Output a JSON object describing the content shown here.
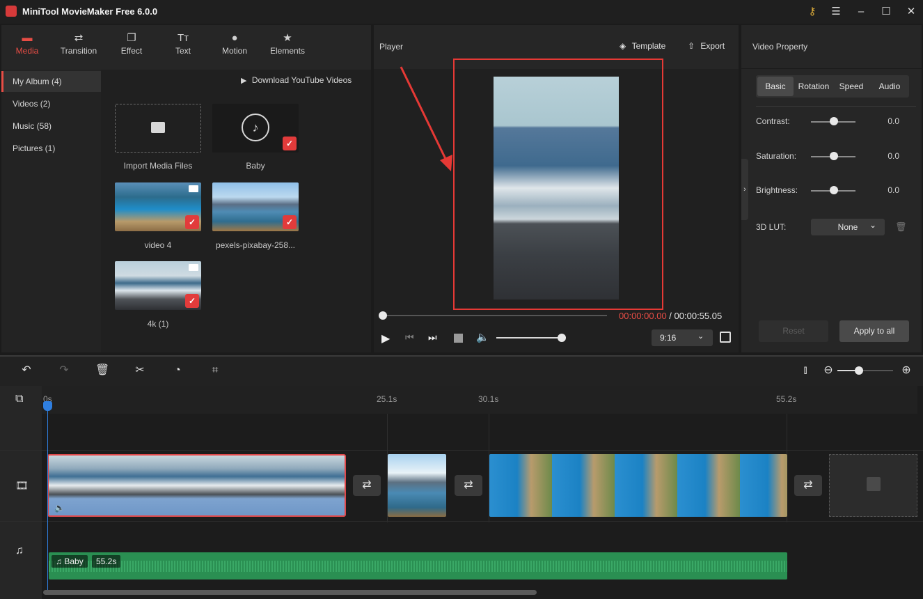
{
  "window": {
    "title": "MiniTool MovieMaker Free 6.0.0"
  },
  "toolbar": {
    "tabs": [
      {
        "label": "Media",
        "icon": "folder-icon"
      },
      {
        "label": "Transition",
        "icon": "transition-arrows-icon"
      },
      {
        "label": "Effect",
        "icon": "effect-icon"
      },
      {
        "label": "Text",
        "icon": "text-icon"
      },
      {
        "label": "Motion",
        "icon": "motion-icon"
      },
      {
        "label": "Elements",
        "icon": "elements-icon"
      }
    ]
  },
  "album": {
    "items": [
      {
        "label": "My Album (4)"
      },
      {
        "label": "Videos (2)"
      },
      {
        "label": "Music (58)"
      },
      {
        "label": "Pictures (1)"
      }
    ],
    "download_label": "Download YouTube Videos"
  },
  "media": {
    "items": [
      {
        "caption": "Import Media Files"
      },
      {
        "caption": "Baby"
      },
      {
        "caption": "video 4"
      },
      {
        "caption": "pexels-pixabay-258..."
      },
      {
        "caption": "4k (1)"
      }
    ]
  },
  "player": {
    "title": "Player",
    "template_label": "Template",
    "export_label": "Export",
    "time_current": "00:00:00.00",
    "time_sep": " / ",
    "time_total": "00:00:55.05",
    "aspect": "9:16",
    "progress": 0,
    "volume": 0.95
  },
  "property": {
    "title": "Video Property",
    "tabs": [
      "Basic",
      "Rotation",
      "Speed",
      "Audio"
    ],
    "rows": [
      {
        "label": "Contrast:",
        "value": "0.0"
      },
      {
        "label": "Saturation:",
        "value": "0.0"
      },
      {
        "label": "Brightness:",
        "value": "0.0"
      }
    ],
    "lut_label": "3D LUT:",
    "lut_value": "None",
    "reset_label": "Reset",
    "apply_label": "Apply to all"
  },
  "timeline": {
    "ruler": [
      "0s",
      "25.1s",
      "30.1s",
      "55.2s"
    ],
    "audio_clip": {
      "name": "Baby",
      "duration": "55.2s"
    }
  },
  "colors": {
    "accent": "#e84d45",
    "audio": "#2a8f52",
    "playhead": "#2f7fe0"
  }
}
